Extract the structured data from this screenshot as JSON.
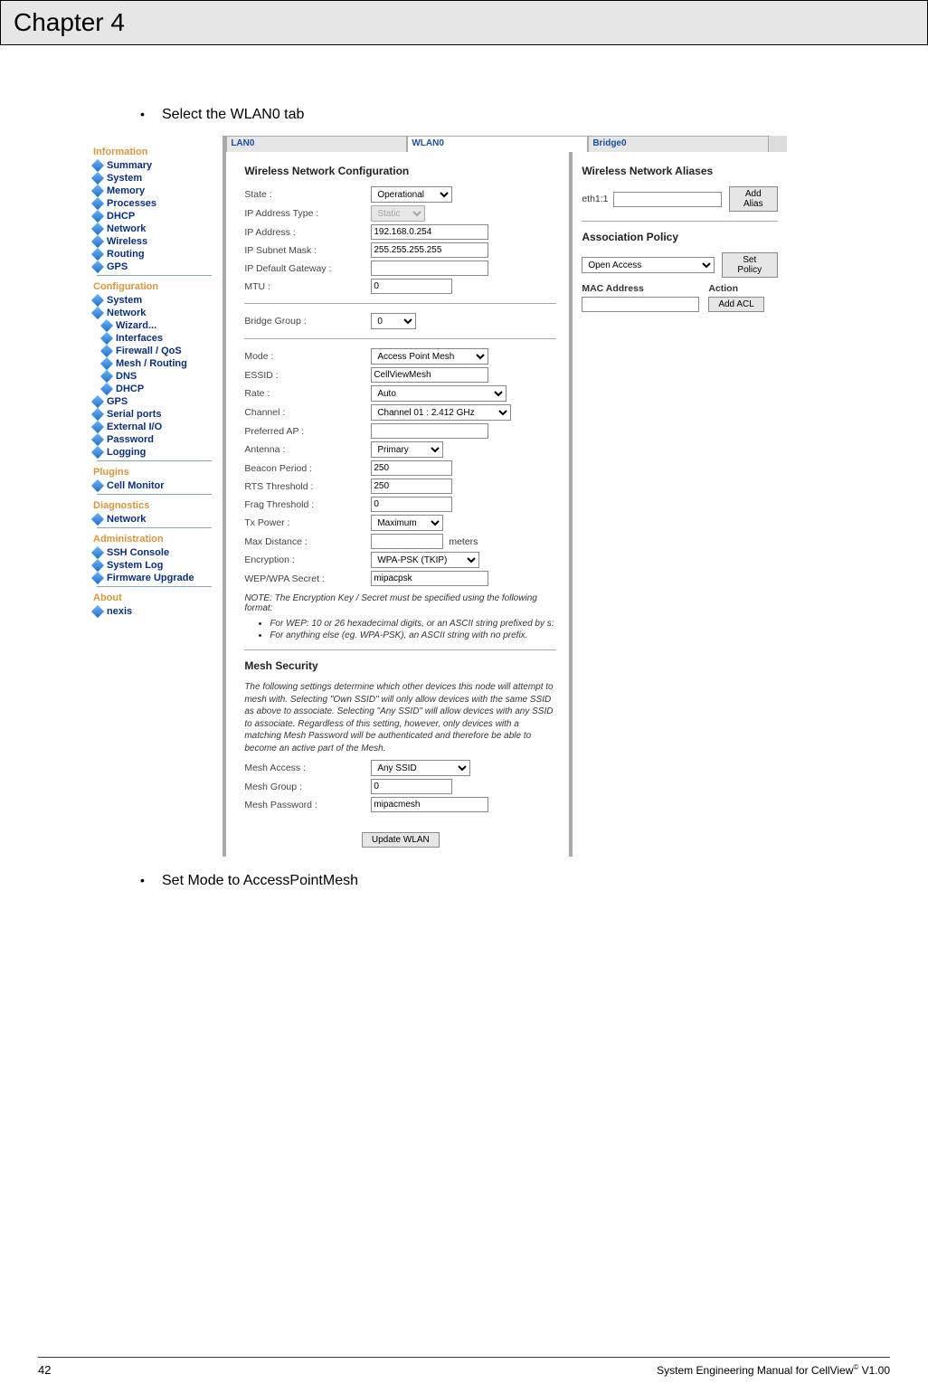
{
  "chapter_title": "Chapter 4",
  "bullet1": "Select the WLAN0 tab",
  "bullet2": "Set Mode to AccessPointMesh",
  "page_number": "42",
  "footer_right": "System Engineering Manual for CellView",
  "footer_right_sup": "©",
  "footer_right_ver": " V1.00",
  "sidebar": {
    "sections": [
      {
        "title": "Information",
        "items": [
          "Summary",
          "System",
          "Memory",
          "Processes",
          "DHCP",
          "Network",
          "Wireless",
          "Routing",
          "GPS"
        ]
      },
      {
        "title": "Configuration",
        "items": [
          "System",
          "Network"
        ],
        "subitems": [
          "Wizard...",
          "Interfaces",
          "Firewall / QoS",
          "Mesh / Routing",
          "DNS",
          "DHCP"
        ],
        "items2": [
          "GPS",
          "Serial ports",
          "External I/O",
          "Password",
          "Logging"
        ]
      },
      {
        "title": "Plugins",
        "items": [
          "Cell Monitor"
        ]
      },
      {
        "title": "Diagnostics",
        "items": [
          "Network"
        ]
      },
      {
        "title": "Administration",
        "items": [
          "SSH Console",
          "System Log",
          "Firmware Upgrade"
        ]
      },
      {
        "title": "About",
        "items": [
          "nexis"
        ]
      }
    ]
  },
  "tabs": {
    "lan0": "LAN0",
    "wlan0": "WLAN0",
    "bridge0": "Bridge0"
  },
  "wnc": {
    "heading": "Wireless Network Configuration",
    "state_label": "State :",
    "state_val": "Operational",
    "iptype_label": "IP Address Type :",
    "iptype_val": "Static",
    "ip_label": "IP Address :",
    "ip_val": "192.168.0.254",
    "mask_label": "IP Subnet Mask :",
    "mask_val": "255.255.255.255",
    "gw_label": "IP Default Gateway :",
    "gw_val": "",
    "mtu_label": "MTU :",
    "mtu_val": "0",
    "bridge_label": "Bridge Group :",
    "bridge_val": "0",
    "mode_label": "Mode :",
    "mode_val": "Access Point Mesh",
    "essid_label": "ESSID :",
    "essid_val": "CellViewMesh",
    "rate_label": "Rate :",
    "rate_val": "Auto",
    "channel_label": "Channel :",
    "channel_val": "Channel 01 : 2.412 GHz",
    "prefap_label": "Preferred AP :",
    "prefap_val": "",
    "antenna_label": "Antenna :",
    "antenna_val": "Primary",
    "beacon_label": "Beacon Period :",
    "beacon_val": "250",
    "rts_label": "RTS Threshold :",
    "rts_val": "250",
    "frag_label": "Frag Threshold :",
    "frag_val": "0",
    "txp_label": "Tx Power :",
    "txp_val": "Maximum",
    "maxd_label": "Max Distance :",
    "maxd_val": "",
    "maxd_unit": "meters",
    "enc_label": "Encryption :",
    "enc_val": "WPA-PSK (TKIP)",
    "wep_label": "WEP/WPA Secret :",
    "wep_val": "mipacpsk",
    "note_intro": "NOTE: The Encryption Key / Secret must be specified using the following format:",
    "note_li1": "For WEP: 10 or 26 hexadecimal digits, or an ASCII string prefixed by s:",
    "note_li2": "For anything else (eg. WPA-PSK), an ASCII string with no prefix.",
    "mesh_heading": "Mesh Security",
    "mesh_desc": "The following settings determine which other devices this node will attempt to mesh with. Selecting \"Own SSID\" will only allow devices with the same SSID as above to associate. Selecting \"Any SSID\" will allow devices with any SSID to associate.\nRegardless of this setting, however, only devices with a matching Mesh Password will be authenticated and therefore be able to become an active part of the Mesh.",
    "meshacc_label": "Mesh Access :",
    "meshacc_val": "Any SSID",
    "meshgrp_label": "Mesh Group :",
    "meshgrp_val": "0",
    "meshpw_label": "Mesh Password :",
    "meshpw_val": "mipacmesh",
    "update_btn": "Update WLAN"
  },
  "aliases": {
    "heading": "Wireless Network Aliases",
    "eth_label": "eth1:1",
    "addalias": "Add Alias"
  },
  "policy": {
    "heading": "Association Policy",
    "val": "Open Access",
    "setpolicy": "Set Policy",
    "mac_h": "MAC Address",
    "action_h": "Action",
    "addacl": "Add ACL"
  }
}
